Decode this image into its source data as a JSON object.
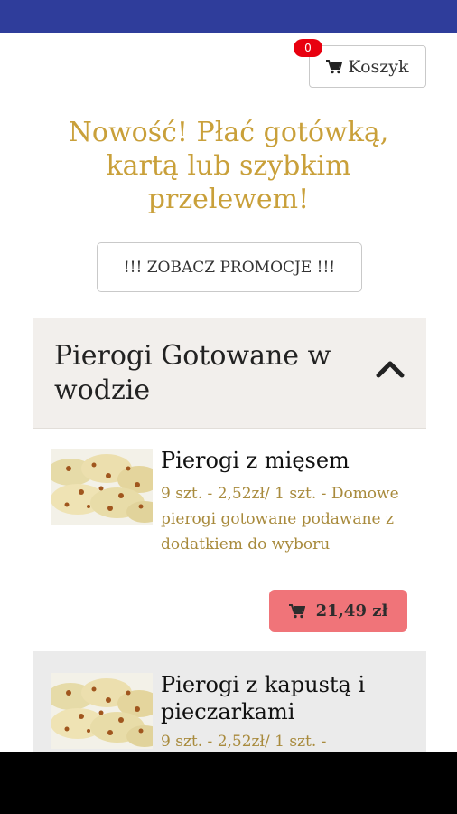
{
  "cart": {
    "label": "Koszyk",
    "badge_count": "0",
    "icon": "shopping-cart-icon"
  },
  "promo": {
    "headline": "Nowość! Płać gotówką, kartą lub szybkim przelewem!",
    "button_label": "!!! ZOBACZ PROMOCJE !!!"
  },
  "category": {
    "title": "Pierogi Gotowane w wodzie",
    "toggle_icon": "chevron-up-icon"
  },
  "products": [
    {
      "name": "Pierogi z mięsem",
      "description": "9 szt. - 2,52zł/ 1 szt. - Domowe pierogi gotowane podawane z dodatkiem do wyboru",
      "price": "21,49 zł"
    },
    {
      "name": "Pierogi z kapustą i pieczarkami",
      "description": "9 szt. - 2,52zł/ 1 szt. -"
    }
  ],
  "colors": {
    "status_bar": "#2f3d9b",
    "headline": "#c9a03a",
    "price_button": "#f07479",
    "badge": "#e8000f",
    "category_bg": "#f2efec"
  }
}
